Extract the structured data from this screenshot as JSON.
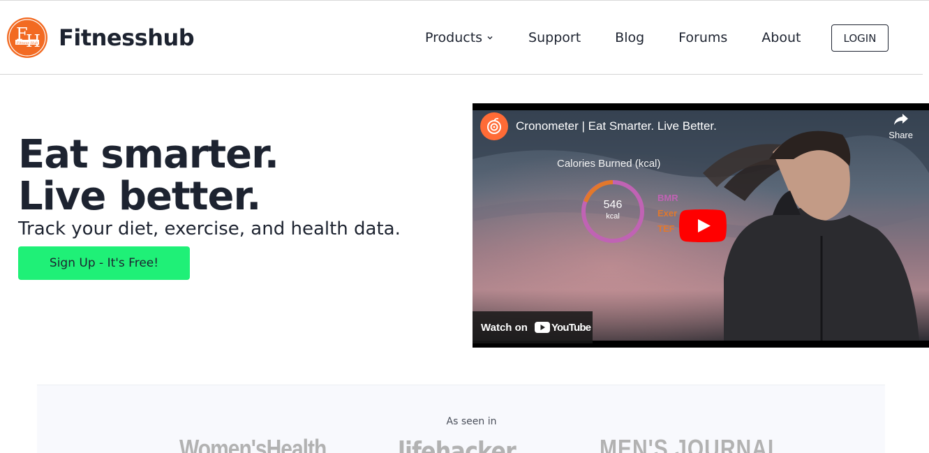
{
  "brand": {
    "name": "Fitnesshub",
    "logo_alt": "Fitness Hub logo"
  },
  "nav": {
    "items": [
      {
        "label": "Products",
        "has_dropdown": true
      },
      {
        "label": "Support"
      },
      {
        "label": "Blog"
      },
      {
        "label": "Forums"
      },
      {
        "label": "About"
      }
    ],
    "login_label": "LOGIN"
  },
  "hero": {
    "title_line1": "Eat smarter.",
    "title_line2": "Live better.",
    "subtitle": "Track your diet, exercise, and health data.",
    "cta_label": "Sign Up - It's Free!"
  },
  "video": {
    "title": "Cronometer | Eat Smarter. Live Better.",
    "share_label": "Share",
    "overlay_label": "Calories Burned (kcal)",
    "ring_value": "546",
    "ring_unit": "kcal",
    "legend": [
      "BMR",
      "Exer",
      "TEF"
    ],
    "watch_on_label": "Watch on",
    "youtube_label": "YouTube"
  },
  "press": {
    "label": "As seen in",
    "logos": [
      "Women'sHealth",
      "lifehacker",
      "MEN'S JOURNAL"
    ]
  },
  "colors": {
    "cta": "#1ff077",
    "text": "#1d2330",
    "brand_orange": "#f26a22",
    "youtube_red": "#ff0000"
  }
}
